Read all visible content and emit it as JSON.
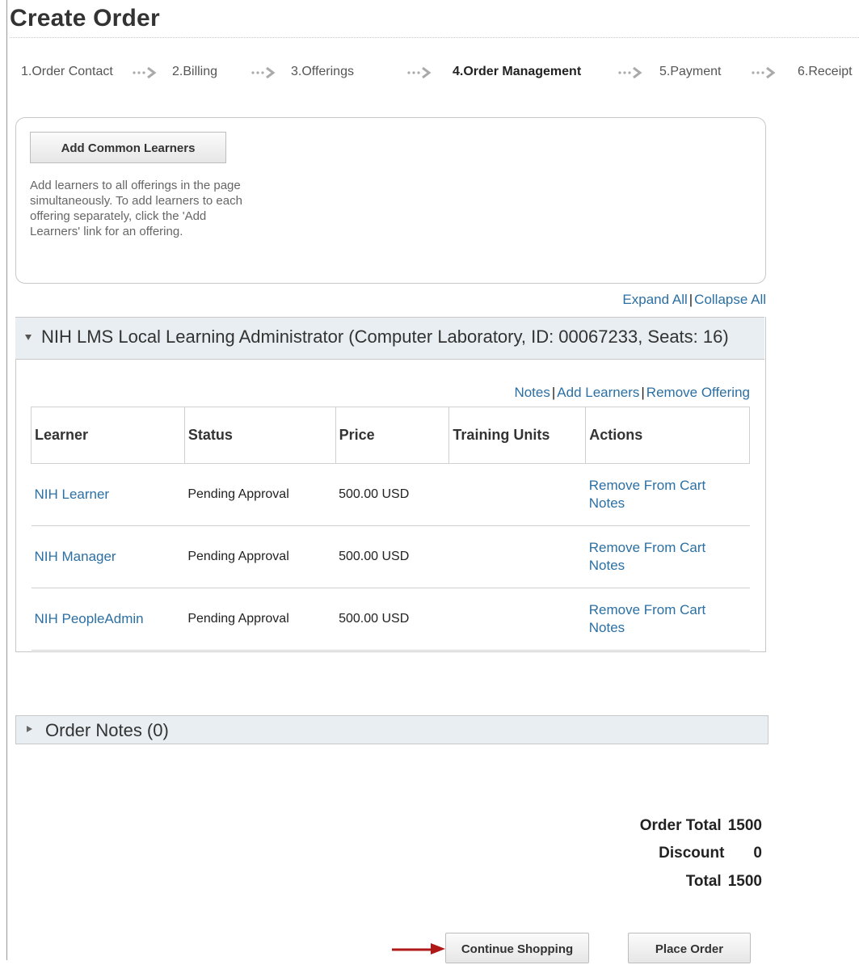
{
  "page": {
    "title": "Create Order"
  },
  "steps": [
    {
      "label": "1.Order Contact",
      "active": false
    },
    {
      "label": "2.Billing",
      "active": false
    },
    {
      "label": "3.Offerings",
      "active": false
    },
    {
      "label": "4.Order Management",
      "active": true
    },
    {
      "label": "5.Payment",
      "active": false
    },
    {
      "label": "6.Receipt",
      "active": false
    }
  ],
  "common": {
    "button_label": "Add Common Learners",
    "help_text": "Add learners to all offerings in the page simultaneously. To add learners to each offering separately, click the 'Add Learners' link for an offering."
  },
  "expand": {
    "expand_all": "Expand All",
    "separator": "|",
    "collapse_all": "Collapse All"
  },
  "offering": {
    "title": "NIH LMS Local Learning Administrator (Computer Laboratory, ID: 00067233, Seats: 16)",
    "links": {
      "notes": "Notes",
      "add_learners": "Add Learners",
      "remove_offering": "Remove Offering",
      "separator": "|"
    },
    "columns": [
      "Learner",
      "Status",
      "Price",
      "Training Units",
      "Actions"
    ],
    "rows": [
      {
        "learner": "NIH Learner",
        "status": "Pending Approval",
        "price": "500.00 USD",
        "training_units": "",
        "action_remove": "Remove From Cart",
        "action_notes": "Notes"
      },
      {
        "learner": "NIH Manager",
        "status": "Pending Approval",
        "price": "500.00 USD",
        "training_units": "",
        "action_remove": "Remove From Cart",
        "action_notes": "Notes"
      },
      {
        "learner": "NIH PeopleAdmin",
        "status": "Pending Approval",
        "price": "500.00 USD",
        "training_units": "",
        "action_remove": "Remove From Cart",
        "action_notes": "Notes"
      }
    ]
  },
  "order_notes": {
    "label": "Order Notes (0)"
  },
  "totals": {
    "order_total_label": "Order Total",
    "order_total_value": "1500",
    "discount_label": "Discount",
    "discount_value": "0",
    "total_label": "Total",
    "total_value": "1500"
  },
  "buttons": {
    "continue_shopping": "Continue Shopping",
    "place_order": "Place Order"
  },
  "colors": {
    "link": "#2b6fa3",
    "header_bg": "#e8eef1",
    "arrow_red": "#b01818"
  }
}
